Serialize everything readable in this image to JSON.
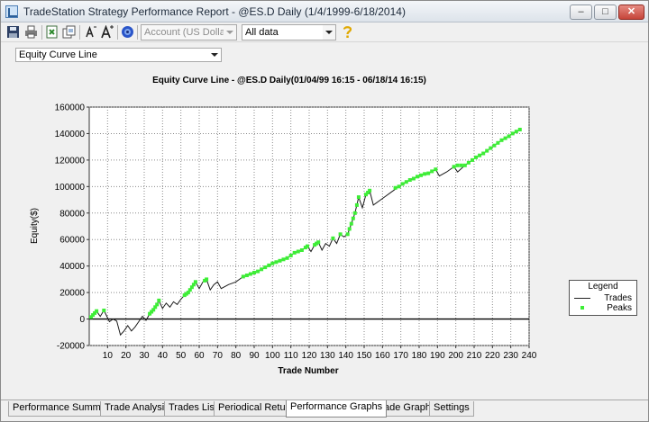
{
  "window": {
    "title": "TradeStation Strategy Performance Report - @ES.D Daily (1/4/1999-6/18/2014)"
  },
  "toolbar": {
    "account_combo": "Account (US Dollar)",
    "data_combo": "All data"
  },
  "graph_selector": {
    "value": "Equity Curve Line"
  },
  "tabs": [
    {
      "label": "Performance Summary"
    },
    {
      "label": "Trade Analysis"
    },
    {
      "label": "Trades List"
    },
    {
      "label": "Periodical Returns"
    },
    {
      "label": "Performance Graphs",
      "active": true
    },
    {
      "label": "Trade Graphs"
    },
    {
      "label": "Settings"
    }
  ],
  "colors": {
    "trades": "#1a1a1a",
    "peaks": "#3dee36",
    "zero_line": "#000000"
  },
  "chart_data": {
    "type": "line",
    "title": "Equity Curve Line - @ES.D Daily(01/04/99 16:15 - 06/18/14 16:15)",
    "xlabel": "Trade Number",
    "ylabel": "Equity($)",
    "xlim": [
      0,
      240
    ],
    "ylim": [
      -20000,
      160000
    ],
    "xticks": [
      10,
      20,
      30,
      40,
      50,
      60,
      70,
      80,
      90,
      100,
      110,
      120,
      130,
      140,
      150,
      160,
      170,
      180,
      190,
      200,
      210,
      220,
      230,
      240
    ],
    "yticks": [
      -20000,
      0,
      20000,
      40000,
      60000,
      80000,
      100000,
      120000,
      140000,
      160000
    ],
    "ytick_labels": [
      "-20000",
      "0",
      "20000",
      "40000",
      "60000",
      "80000",
      "100000",
      "120000",
      "140000",
      "160000"
    ],
    "grid": true,
    "legend": {
      "title": "Legend",
      "position": "right",
      "entries": [
        "Trades",
        "Peaks"
      ]
    },
    "series": [
      {
        "name": "Trades",
        "style": "line",
        "points": [
          [
            0,
            0
          ],
          [
            2,
            3000
          ],
          [
            4,
            6000
          ],
          [
            6,
            2000
          ],
          [
            8,
            6500
          ],
          [
            10,
            1000
          ],
          [
            11,
            -2000
          ],
          [
            13,
            0
          ],
          [
            15,
            -1500
          ],
          [
            17,
            -12000
          ],
          [
            19,
            -9000
          ],
          [
            21,
            -5000
          ],
          [
            23,
            -9000
          ],
          [
            25,
            -6000
          ],
          [
            27,
            -2000
          ],
          [
            29,
            2000
          ],
          [
            31,
            -1000
          ],
          [
            33,
            4000
          ],
          [
            35,
            7000
          ],
          [
            37,
            11000
          ],
          [
            38,
            14000
          ],
          [
            40,
            8000
          ],
          [
            42,
            12000
          ],
          [
            44,
            9000
          ],
          [
            46,
            13000
          ],
          [
            48,
            11000
          ],
          [
            50,
            15000
          ],
          [
            52,
            18000
          ],
          [
            54,
            20000
          ],
          [
            56,
            24000
          ],
          [
            58,
            28000
          ],
          [
            60,
            23000
          ],
          [
            62,
            28000
          ],
          [
            64,
            30000
          ],
          [
            66,
            22000
          ],
          [
            68,
            26000
          ],
          [
            70,
            28000
          ],
          [
            72,
            23000
          ],
          [
            76,
            26000
          ],
          [
            80,
            28000
          ],
          [
            84,
            32000
          ],
          [
            88,
            34000
          ],
          [
            92,
            36000
          ],
          [
            96,
            39000
          ],
          [
            100,
            42000
          ],
          [
            104,
            44000
          ],
          [
            108,
            46000
          ],
          [
            112,
            50000
          ],
          [
            116,
            52000
          ],
          [
            119,
            55000
          ],
          [
            121,
            51000
          ],
          [
            123,
            56000
          ],
          [
            125,
            58000
          ],
          [
            127,
            52000
          ],
          [
            129,
            57000
          ],
          [
            131,
            55000
          ],
          [
            133,
            61000
          ],
          [
            135,
            57000
          ],
          [
            137,
            64000
          ],
          [
            139,
            62000
          ],
          [
            141,
            64000
          ],
          [
            143,
            72000
          ],
          [
            145,
            80000
          ],
          [
            147,
            92000
          ],
          [
            149,
            84000
          ],
          [
            151,
            94000
          ],
          [
            153,
            97000
          ],
          [
            155,
            86000
          ],
          [
            160,
            91000
          ],
          [
            165,
            96000
          ],
          [
            170,
            101000
          ],
          [
            175,
            105000
          ],
          [
            180,
            108000
          ],
          [
            185,
            110000
          ],
          [
            189,
            113000
          ],
          [
            191,
            108000
          ],
          [
            195,
            111000
          ],
          [
            199,
            115000
          ],
          [
            201,
            111000
          ],
          [
            205,
            116000
          ],
          [
            210,
            121000
          ],
          [
            215,
            125000
          ],
          [
            220,
            130000
          ],
          [
            225,
            135000
          ],
          [
            230,
            139000
          ],
          [
            235,
            143000
          ]
        ]
      },
      {
        "name": "Peaks",
        "style": "markers",
        "points": [
          [
            1,
            1500
          ],
          [
            2,
            3000
          ],
          [
            3,
            4500
          ],
          [
            4,
            6000
          ],
          [
            8,
            6500
          ],
          [
            33,
            4000
          ],
          [
            34,
            5500
          ],
          [
            35,
            7000
          ],
          [
            36,
            9000
          ],
          [
            37,
            11000
          ],
          [
            38,
            14000
          ],
          [
            52,
            18000
          ],
          [
            53,
            19000
          ],
          [
            54,
            20000
          ],
          [
            55,
            22000
          ],
          [
            56,
            24000
          ],
          [
            57,
            26000
          ],
          [
            58,
            28000
          ],
          [
            63,
            29000
          ],
          [
            64,
            30000
          ],
          [
            84,
            32000
          ],
          [
            86,
            33000
          ],
          [
            88,
            34000
          ],
          [
            90,
            35000
          ],
          [
            92,
            36000
          ],
          [
            94,
            37500
          ],
          [
            96,
            39000
          ],
          [
            98,
            40500
          ],
          [
            100,
            42000
          ],
          [
            102,
            43000
          ],
          [
            104,
            44000
          ],
          [
            106,
            45000
          ],
          [
            108,
            46000
          ],
          [
            110,
            48000
          ],
          [
            112,
            50000
          ],
          [
            114,
            51000
          ],
          [
            116,
            52000
          ],
          [
            118,
            54000
          ],
          [
            119,
            55000
          ],
          [
            123,
            56000
          ],
          [
            124,
            57000
          ],
          [
            125,
            58000
          ],
          [
            133,
            61000
          ],
          [
            137,
            64000
          ],
          [
            141,
            64000
          ],
          [
            142,
            68000
          ],
          [
            143,
            72000
          ],
          [
            144,
            76000
          ],
          [
            145,
            80000
          ],
          [
            146,
            86000
          ],
          [
            147,
            92000
          ],
          [
            151,
            94000
          ],
          [
            152,
            95500
          ],
          [
            153,
            97000
          ],
          [
            167,
            99000
          ],
          [
            169,
            100000
          ],
          [
            171,
            102000
          ],
          [
            173,
            103500
          ],
          [
            175,
            105000
          ],
          [
            177,
            106000
          ],
          [
            179,
            107500
          ],
          [
            181,
            108500
          ],
          [
            183,
            109500
          ],
          [
            185,
            110000
          ],
          [
            187,
            111500
          ],
          [
            189,
            113000
          ],
          [
            199,
            115000
          ],
          [
            201,
            116000
          ],
          [
            203,
            116000
          ],
          [
            205,
            116000
          ],
          [
            207,
            118000
          ],
          [
            209,
            120000
          ],
          [
            211,
            122000
          ],
          [
            213,
            123500
          ],
          [
            215,
            125000
          ],
          [
            217,
            127000
          ],
          [
            219,
            129000
          ],
          [
            221,
            131000
          ],
          [
            223,
            133000
          ],
          [
            225,
            135000
          ],
          [
            227,
            136500
          ],
          [
            229,
            138000
          ],
          [
            231,
            140000
          ],
          [
            233,
            141500
          ],
          [
            235,
            143000
          ]
        ]
      }
    ]
  }
}
